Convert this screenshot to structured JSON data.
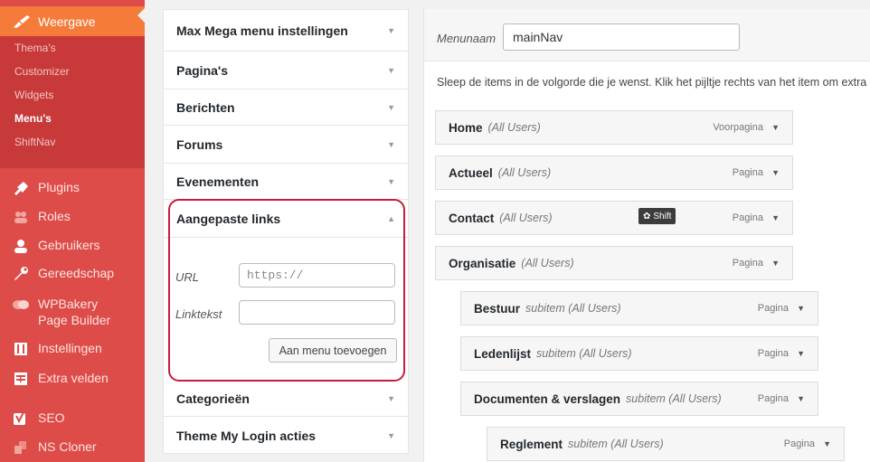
{
  "sidebar": {
    "active": {
      "label": "Weergave",
      "icon": "paintbrush-icon"
    },
    "submenu": [
      {
        "label": "Thema's"
      },
      {
        "label": "Customizer"
      },
      {
        "label": "Widgets"
      },
      {
        "label": "Menu's",
        "current": true
      },
      {
        "label": "ShiftNav"
      }
    ],
    "items": [
      {
        "label": "Plugins",
        "icon": "plugin-icon"
      },
      {
        "label": "Roles",
        "icon": "roles-icon"
      },
      {
        "label": "Gebruikers",
        "icon": "users-icon"
      },
      {
        "label": "Gereedschap",
        "icon": "wrench-icon"
      },
      {
        "label": "WPBakery Page Builder",
        "icon": "wpbakery-icon"
      },
      {
        "label": "Instellingen",
        "icon": "settings-icon"
      },
      {
        "label": "Extra velden",
        "icon": "fields-icon"
      },
      {
        "label": "SEO",
        "icon": "seo-icon"
      },
      {
        "label": "NS Cloner",
        "icon": "cloner-icon"
      }
    ]
  },
  "panels": {
    "accordion": [
      {
        "label": "Max Mega menu instellingen"
      },
      {
        "label": "Pagina's"
      },
      {
        "label": "Berichten"
      },
      {
        "label": "Forums"
      },
      {
        "label": "Evenementen"
      },
      {
        "label": "Aangepaste links",
        "open": true
      },
      {
        "label": "Categorieën"
      },
      {
        "label": "Theme My Login acties"
      }
    ],
    "custom_links": {
      "url_label": "URL",
      "url_placeholder": "https://",
      "linktext_label": "Linktekst",
      "linktext_value": "",
      "add_button": "Aan menu toevoegen"
    }
  },
  "menu": {
    "name_label": "Menunaam",
    "name_value": "mainNav",
    "instructions": "Sleep de items in de volgorde die je wenst. Klik het pijltje rechts van het item om extra c",
    "shift_badge": "Shift",
    "items": [
      {
        "title": "Home",
        "sub": "(All Users)",
        "type": "Voorpagina",
        "depth": 0
      },
      {
        "title": "Actueel",
        "sub": "(All Users)",
        "type": "Pagina",
        "depth": 0
      },
      {
        "title": "Contact",
        "sub": "(All Users)",
        "type": "Pagina",
        "depth": 0
      },
      {
        "title": "Organisatie",
        "sub": "(All Users)",
        "type": "Pagina",
        "depth": 0
      },
      {
        "title": "Bestuur",
        "sub": "subitem  (All Users)",
        "type": "Pagina",
        "depth": 1
      },
      {
        "title": "Ledenlijst",
        "sub": "subitem  (All Users)",
        "type": "Pagina",
        "depth": 1
      },
      {
        "title": "Documenten & verslagen",
        "sub": "subitem  (All Users)",
        "type": "Pagina",
        "depth": 1
      },
      {
        "title": "Reglement",
        "sub": "subitem  (All Users)",
        "type": "Pagina",
        "depth": 2
      }
    ]
  }
}
